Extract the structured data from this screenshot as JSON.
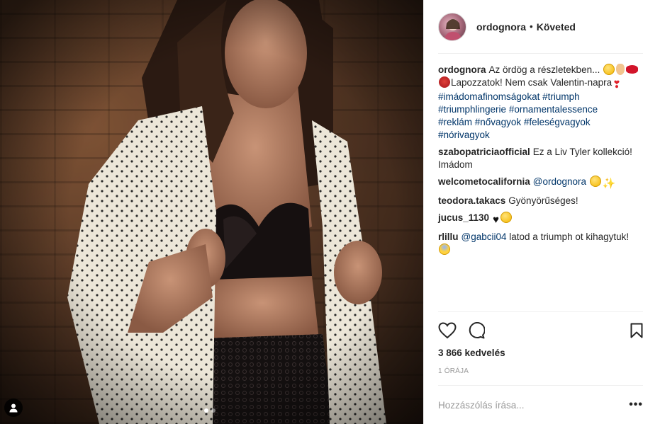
{
  "header": {
    "username": "ordognora",
    "separator": "•",
    "follow_status": "Követed"
  },
  "caption": {
    "username": "ordognora",
    "line1": "Az ördög a részletekben...",
    "line2": "Lapozzatok! Nem csak Valentin-napra",
    "hashtags": [
      "#imádomafinomságokat",
      "#triumph",
      "#triumphlingerie",
      "#ornamentalessence",
      "#reklám",
      "#nővagyok",
      "#feleségvagyok",
      "#nórivagyok"
    ]
  },
  "comments": [
    {
      "username": "szabopatriciaofficial",
      "text": "Ez a Liv Tyler kollekció! Imádom"
    },
    {
      "username": "welcometocalifornia",
      "mention": "@ordognora",
      "text": ""
    },
    {
      "username": "teodora.takacs",
      "text": "Gyönyörűséges!"
    },
    {
      "username": "jucus_1130",
      "text": ""
    },
    {
      "username": "rlillu",
      "mention": "@gabcii04",
      "text": "latod a triumph ot kihagytuk!"
    }
  ],
  "actions": {
    "likes": "3 866 kedvelés",
    "time": "1 órája"
  },
  "add_comment": {
    "placeholder": "Hozzászólás írása...",
    "more": "•••"
  },
  "icons": {
    "like": "heart-outline-icon",
    "comment": "speech-bubble-icon",
    "save": "bookmark-icon",
    "tagged": "user-silhouette-icon"
  },
  "carousel": {
    "count": 2,
    "active_index": 0
  }
}
